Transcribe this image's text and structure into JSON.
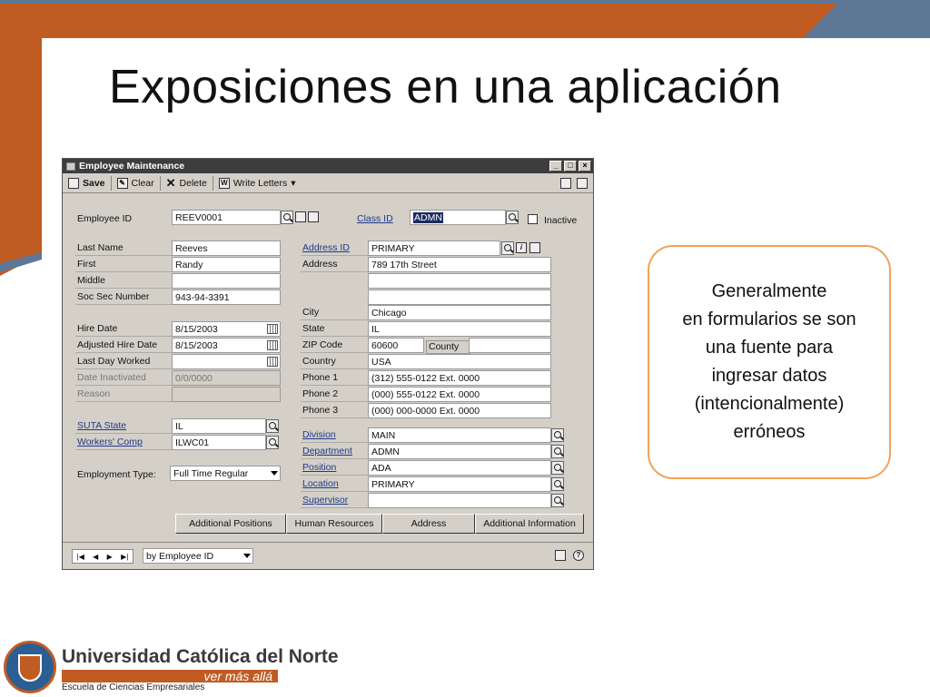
{
  "slide": {
    "title": "Exposiciones en una aplicación",
    "callout": "Generalmente\nen formularios se son\nuna fuente para\ningresar datos\n(intencionalmente)\nerróneos"
  },
  "window": {
    "title": "Employee Maintenance",
    "toolbar": {
      "save": "Save",
      "clear": "Clear",
      "delete": "Delete",
      "write_letters": "Write Letters"
    },
    "fields": {
      "employee_id": {
        "label": "Employee ID",
        "value": "REEV0001"
      },
      "class_id": {
        "label": "Class ID",
        "value": "ADMN"
      },
      "inactive": {
        "label": "Inactive",
        "checked": false
      },
      "last_name": {
        "label": "Last Name",
        "value": "Reeves"
      },
      "first": {
        "label": "First",
        "value": "Randy"
      },
      "middle": {
        "label": "Middle",
        "value": ""
      },
      "ssn": {
        "label": "Soc Sec Number",
        "value": "943-94-3391"
      },
      "hire_date": {
        "label": "Hire Date",
        "value": "8/15/2003"
      },
      "adjusted_hire_date": {
        "label": "Adjusted Hire Date",
        "value": "8/15/2003"
      },
      "last_day_worked": {
        "label": "Last Day Worked",
        "value": ""
      },
      "date_inactivated": {
        "label": "Date Inactivated",
        "value": "0/0/0000"
      },
      "reason": {
        "label": "Reason",
        "value": ""
      },
      "suta_state": {
        "label": "SUTA State",
        "value": "IL"
      },
      "workers_comp": {
        "label": "Workers' Comp",
        "value": "ILWC01"
      },
      "employment_type": {
        "label": "Employment Type:",
        "value": "Full Time Regular"
      },
      "address_id": {
        "label": "Address ID",
        "value": "PRIMARY"
      },
      "address": {
        "label": "Address",
        "value": "789 17th Street"
      },
      "city": {
        "label": "City",
        "value": "Chicago"
      },
      "state": {
        "label": "State",
        "value": "IL"
      },
      "zip": {
        "label": "ZIP Code",
        "value": "60600"
      },
      "county": {
        "label": "County"
      },
      "country": {
        "label": "Country",
        "value": "USA"
      },
      "phone1": {
        "label": "Phone 1",
        "value": "(312) 555-0122  Ext. 0000"
      },
      "phone2": {
        "label": "Phone 2",
        "value": "(000) 555-0122  Ext. 0000"
      },
      "phone3": {
        "label": "Phone 3",
        "value": "(000) 000-0000  Ext. 0000"
      },
      "division": {
        "label": "Division",
        "value": "MAIN"
      },
      "department": {
        "label": "Department",
        "value": "ADMN"
      },
      "position": {
        "label": "Position",
        "value": "ADA"
      },
      "location": {
        "label": "Location",
        "value": "PRIMARY"
      },
      "supervisor": {
        "label": "Supervisor",
        "value": ""
      }
    },
    "buttons": {
      "additional_positions": "Additional Positions",
      "human_resources": "Human Resources",
      "address": "Address",
      "additional_information": "Additional Information"
    },
    "sort_by": "by Employee ID"
  },
  "footer": {
    "university": "Universidad Católica del Norte",
    "tagline": "ver más allá",
    "school": "Escuela de Ciencias Empresariales"
  }
}
